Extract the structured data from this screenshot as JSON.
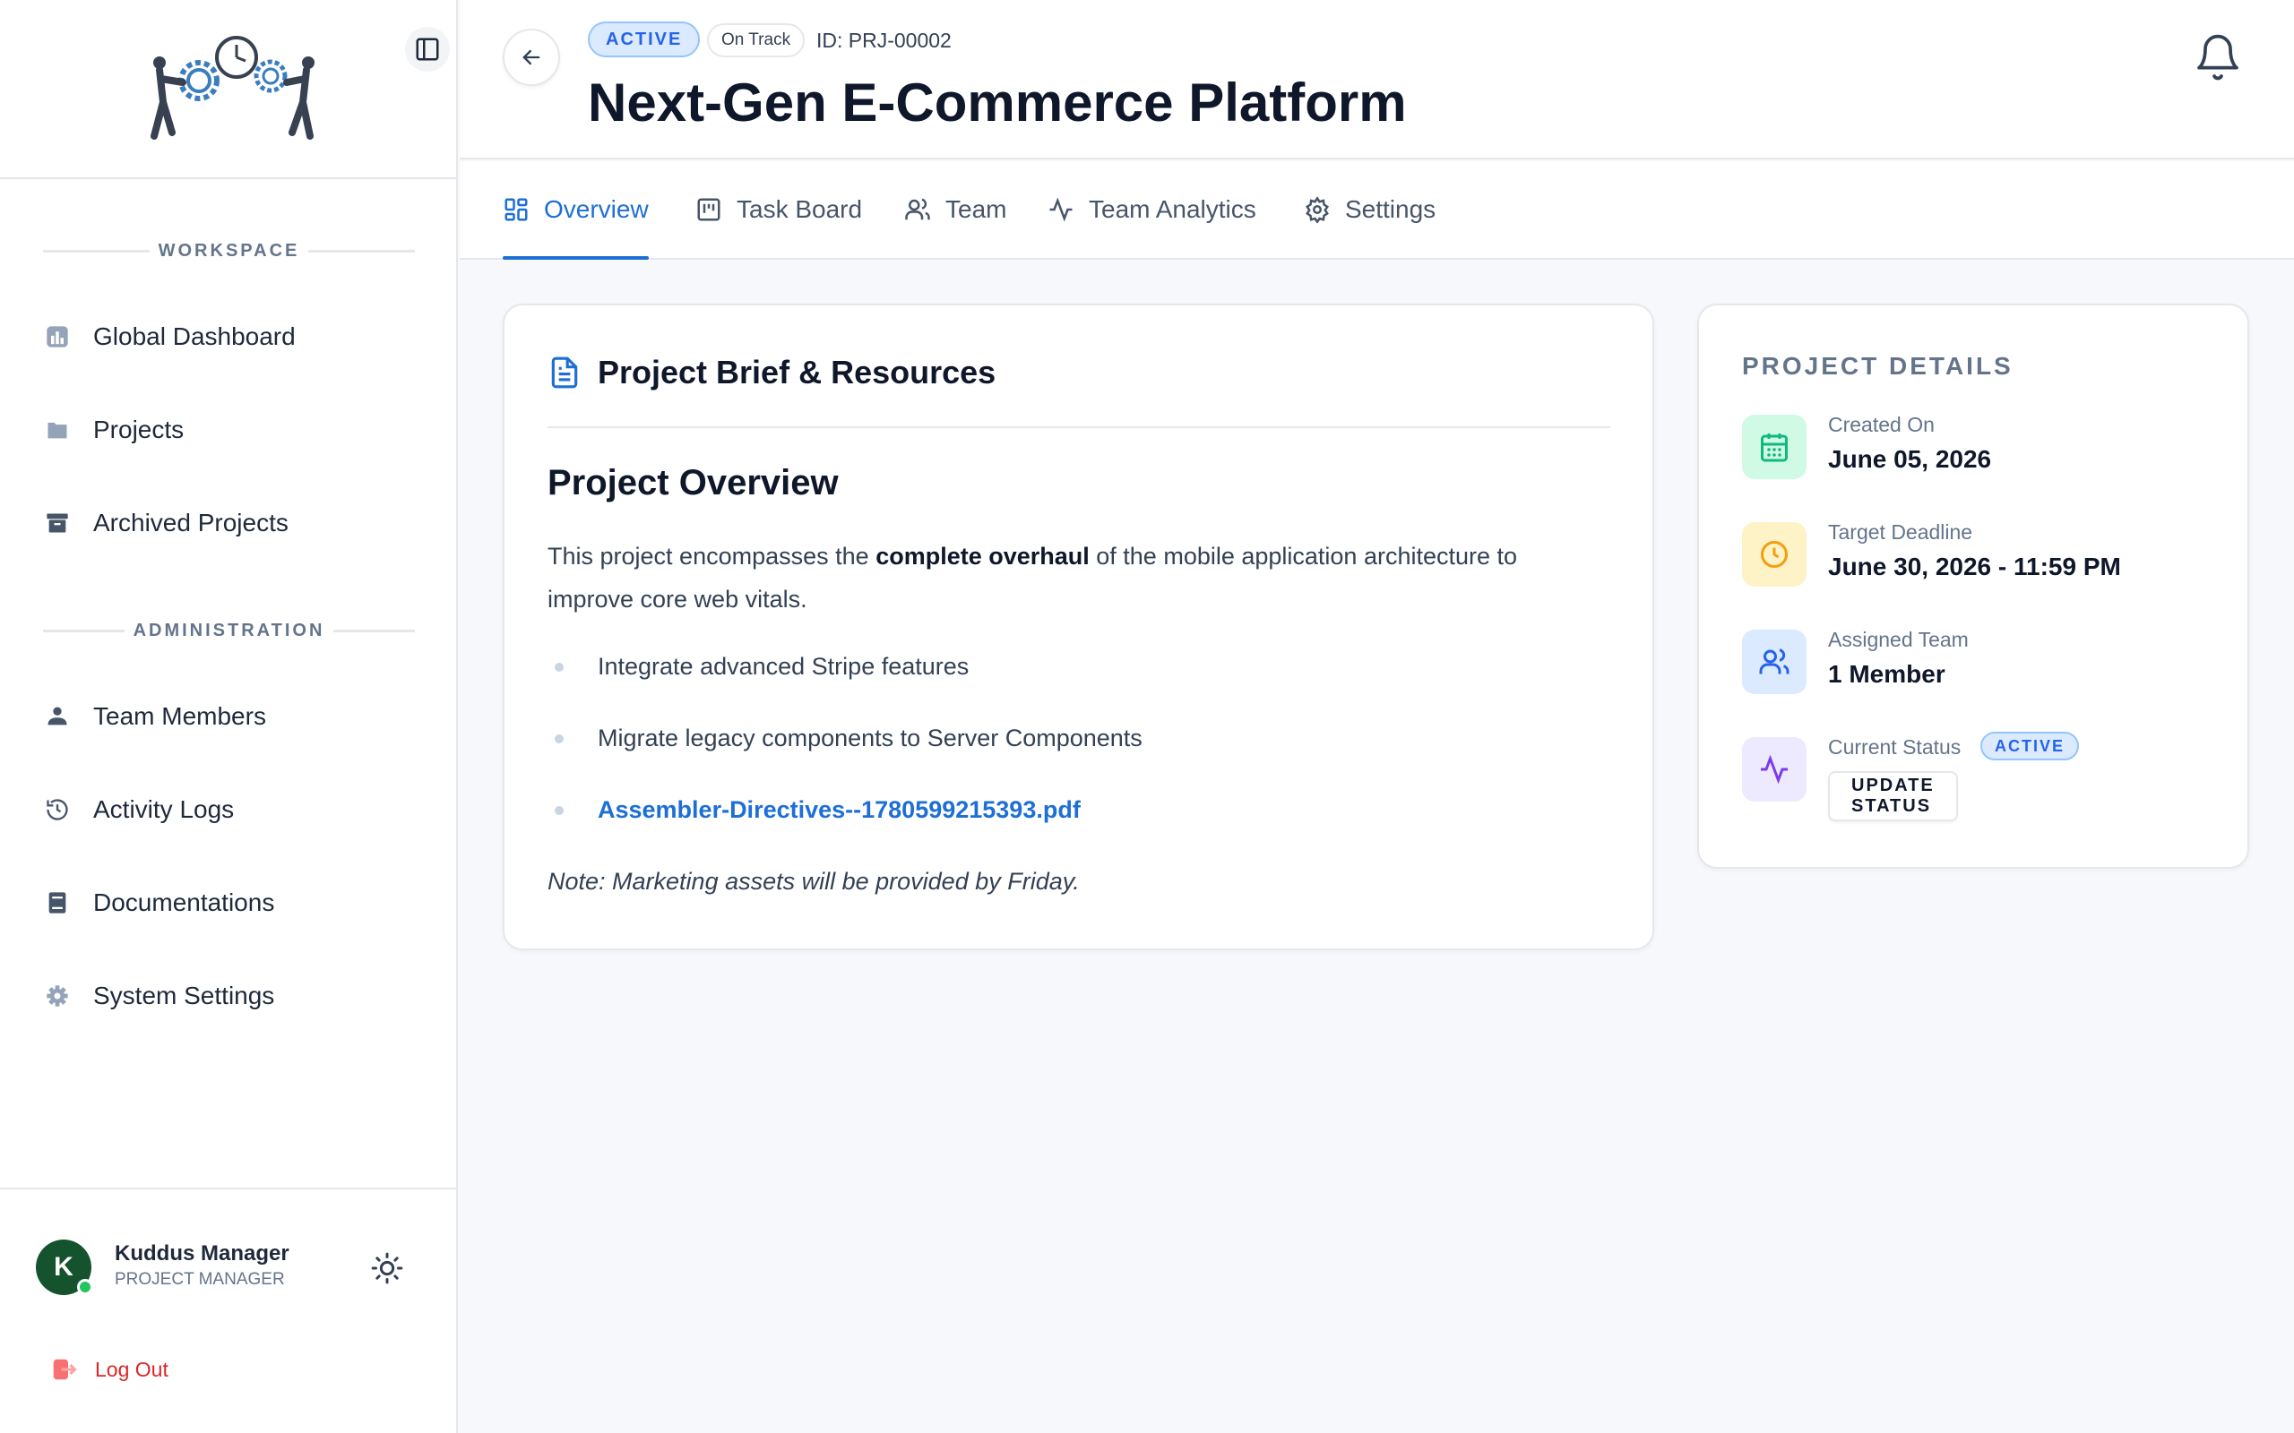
{
  "sidebar": {
    "sections": [
      {
        "label": "WORKSPACE"
      },
      {
        "label": "ADMINISTRATION"
      }
    ],
    "workspace_items": [
      {
        "label": "Global Dashboard",
        "icon": "chart-bar-icon"
      },
      {
        "label": "Projects",
        "icon": "folder-icon"
      },
      {
        "label": "Archived Projects",
        "icon": "archive-icon"
      }
    ],
    "admin_items": [
      {
        "label": "Team Members",
        "icon": "users-icon"
      },
      {
        "label": "Activity Logs",
        "icon": "history-icon"
      },
      {
        "label": "Documentations",
        "icon": "book-icon"
      },
      {
        "label": "System Settings",
        "icon": "gear-icon"
      }
    ],
    "user": {
      "initial": "K",
      "name": "Kuddus Manager",
      "role": "PROJECT MANAGER"
    },
    "logout_label": "Log Out"
  },
  "header": {
    "status_badge": "ACTIVE",
    "track_badge": "On Track",
    "project_id": "ID: PRJ-00002",
    "title": "Next-Gen E-Commerce Platform"
  },
  "tabs": [
    {
      "label": "Overview",
      "icon": "layout-grid-icon",
      "active": true
    },
    {
      "label": "Task Board",
      "icon": "kanban-icon",
      "active": false
    },
    {
      "label": "Team",
      "icon": "users-icon",
      "active": false
    },
    {
      "label": "Team Analytics",
      "icon": "activity-icon",
      "active": false
    },
    {
      "label": "Settings",
      "icon": "gear-icon",
      "active": false
    }
  ],
  "brief": {
    "heading": "Project Brief & Resources",
    "overview_title": "Project Overview",
    "para_before": "This project encompasses the ",
    "para_bold": "complete overhaul",
    "para_after": " of the mobile application architecture to improve core web vitals.",
    "bullets": [
      "Integrate advanced Stripe features",
      "Migrate legacy components to Server Components"
    ],
    "attachment": "Assembler-Directives--1780599215393.pdf",
    "note": "Note: Marketing assets will be provided by Friday."
  },
  "details": {
    "title": "PROJECT DETAILS",
    "created_label": "Created On",
    "created_value": "June 05, 2026",
    "deadline_label": "Target Deadline",
    "deadline_value": "June 30, 2026 - 11:59 PM",
    "team_label": "Assigned Team",
    "team_value": "1 Member",
    "status_label": "Current Status",
    "status_badge": "ACTIVE",
    "update_button": "UPDATE STATUS"
  },
  "colors": {
    "accent": "#1d6fd6",
    "danger": "#dc2626",
    "success": "#22c55e"
  }
}
